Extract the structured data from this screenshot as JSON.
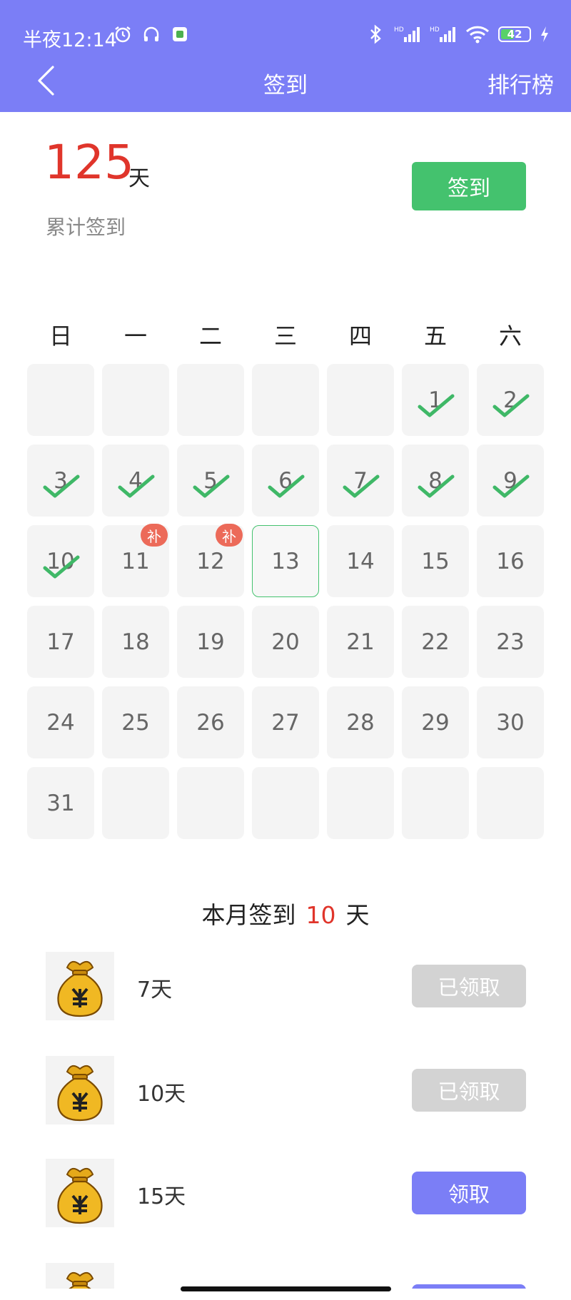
{
  "status_bar": {
    "time": "半夜12:14",
    "battery": "42",
    "left_icons": [
      "alarm-icon",
      "headphones-icon",
      "notification-app-icon"
    ],
    "right_icons": [
      "bluetooth-icon",
      "signal-hd-icon",
      "signal-hd-icon",
      "wifi-icon",
      "battery-icon",
      "charging-icon"
    ]
  },
  "nav": {
    "back_icon": "chevron-left-icon",
    "title": "签到",
    "right_label": "排行榜"
  },
  "summary": {
    "total_days": "125",
    "unit": "天",
    "label": "累计签到",
    "checkin_button": "签到"
  },
  "calendar": {
    "weekdays": [
      "日",
      "一",
      "二",
      "三",
      "四",
      "五",
      "六"
    ],
    "leading_empty": 5,
    "days_in_month": 31,
    "today": 13,
    "checked_days": [
      1,
      2,
      3,
      4,
      5,
      6,
      7,
      8,
      9,
      10
    ],
    "makeup_days": [
      11,
      12
    ],
    "makeup_badge": "补"
  },
  "month_summary": {
    "prefix": "本月签到",
    "count": "10",
    "suffix": "天"
  },
  "rewards": [
    {
      "label": "7天",
      "button": "已领取",
      "status": "claimed"
    },
    {
      "label": "10天",
      "button": "已领取",
      "status": "claimed"
    },
    {
      "label": "15天",
      "button": "领取",
      "status": "claimable"
    }
  ],
  "colors": {
    "header": "#7b7ef6",
    "accent_red": "#e0352b",
    "green": "#44c26e",
    "badge": "#ec6a59",
    "disabled": "#d3d3d3",
    "purple_button": "#7b7ef6"
  }
}
